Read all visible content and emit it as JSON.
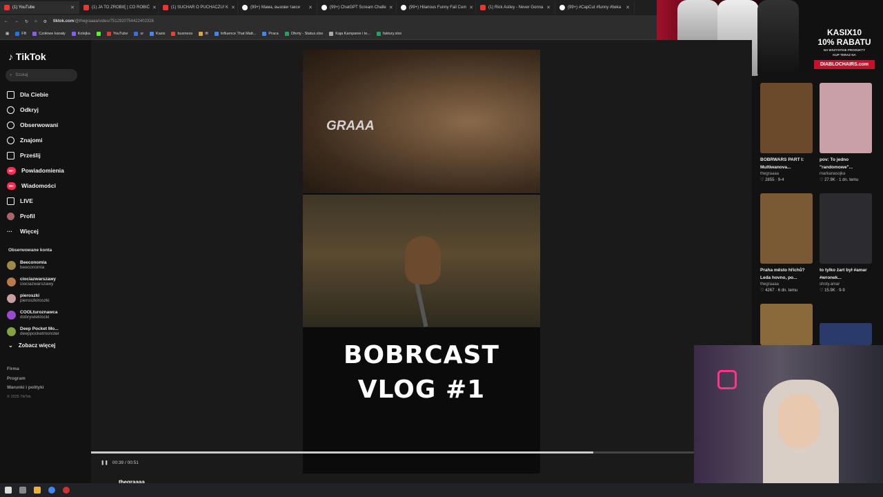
{
  "browser": {
    "tabs": [
      {
        "title": "(1) YouTube",
        "icon": "youtube-icon"
      },
      {
        "title": "(1) JA TO ZROBIĘ | CO ROBIĆ",
        "icon": "youtube-icon"
      },
      {
        "title": "(1) SUCHAR O PUCHACZU! K",
        "icon": "youtube-icon"
      },
      {
        "title": "(99+) Мама, вызови такси",
        "icon": "tiktok-icon"
      },
      {
        "title": "(99+) ChatGPT Scream Challe",
        "icon": "tiktok-icon"
      },
      {
        "title": "(99+) Hilarious Funny Fail Com",
        "icon": "tiktok-icon"
      },
      {
        "title": "(1) Rick Astley - Never Gonna",
        "icon": "youtube-icon"
      },
      {
        "title": "(99+) #CapCut #funny #beka",
        "icon": "tiktok-icon"
      }
    ],
    "url_host": "tiktok.com",
    "url_path": "/@thegraaaa/video/7512920754422402326",
    "bookmarks": [
      "FB",
      "Czołowe kanały",
      "Kolejka",
      "YouTube",
      "sr",
      "Kasix",
      "business",
      "tft",
      "Influence That Matt...",
      "Praca",
      "Oferty - Status.xlsx",
      "Kaja Kampanie i te...",
      "faktury.xlsx"
    ]
  },
  "ad": {
    "code": "KASIX10",
    "discount": "10% RABATU",
    "note": "NA WSZYSTKIE PRODUKTY",
    "cta_small": "KUP TERAZ NA",
    "brand": "DIABLOCHAIRS.com"
  },
  "sidebar": {
    "logo": "TikTok",
    "search_placeholder": "Szukaj",
    "nav": [
      {
        "label": "Dla Ciebie",
        "icon": "home-icon"
      },
      {
        "label": "Odkryj",
        "icon": "compass-icon"
      },
      {
        "label": "Obserwowani",
        "icon": "following-icon"
      },
      {
        "label": "Znajomi",
        "icon": "friends-icon"
      },
      {
        "label": "Prześlij",
        "icon": "upload-icon"
      },
      {
        "label": "Powiadomienia",
        "icon": "notifications-icon",
        "badge": "99+"
      },
      {
        "label": "Wiadomości",
        "icon": "messages-icon",
        "badge": "99+"
      },
      {
        "label": "LIVE",
        "icon": "live-icon"
      },
      {
        "label": "Profil",
        "icon": "profile-avatar"
      },
      {
        "label": "Więcej",
        "icon": "more-icon"
      }
    ],
    "followed_title": "Obserwowane konta",
    "accounts": [
      {
        "name": "Beeconomia",
        "handle": "beeconomia"
      },
      {
        "name": "ciociazwarszawy",
        "handle": "ciociazwarszawy"
      },
      {
        "name": "pieroszki",
        "handle": "pieroszkiroszki"
      },
      {
        "name": "COOLturoznawca",
        "handle": "dobrywieklocki"
      },
      {
        "name": "Deep Pocket Mo...",
        "handle": "deeppocketmonster"
      }
    ],
    "see_more": "Zobacz więcej",
    "footer": [
      "Firma",
      "Program",
      "Warunki i polityki"
    ],
    "copyright": "© 2025 TikTok"
  },
  "video": {
    "watermark": "GRAAA",
    "title_line1": "BOBRCAST",
    "title_line2": "VLOG #1",
    "time": "00:39 / 00:51",
    "progress": 0.76,
    "username": "thegraaaa"
  },
  "recommended": [
    {
      "title": "BOBRWARS PART I: Multiwanova...",
      "author": "thegraaaa",
      "likes": "2855",
      "age": "9-4",
      "color": "#6a4a2a"
    },
    {
      "title": "pov: To jedno \"randomowe\"...",
      "author": "markanasojka",
      "likes": "27.9K",
      "age": "1 dn. temu",
      "color": "#c9a0a8"
    },
    {
      "title": "Praha město hříchů? Leda hovno, po...",
      "author": "thegraaaa",
      "likes": "4267",
      "age": "6 dn. temu",
      "color": "#7a5a34"
    },
    {
      "title": "to tylko żart był #amar #wronek...",
      "author": "shoty.amar",
      "likes": "15.9K",
      "age": "9-9",
      "color": "#2c2c30"
    }
  ]
}
